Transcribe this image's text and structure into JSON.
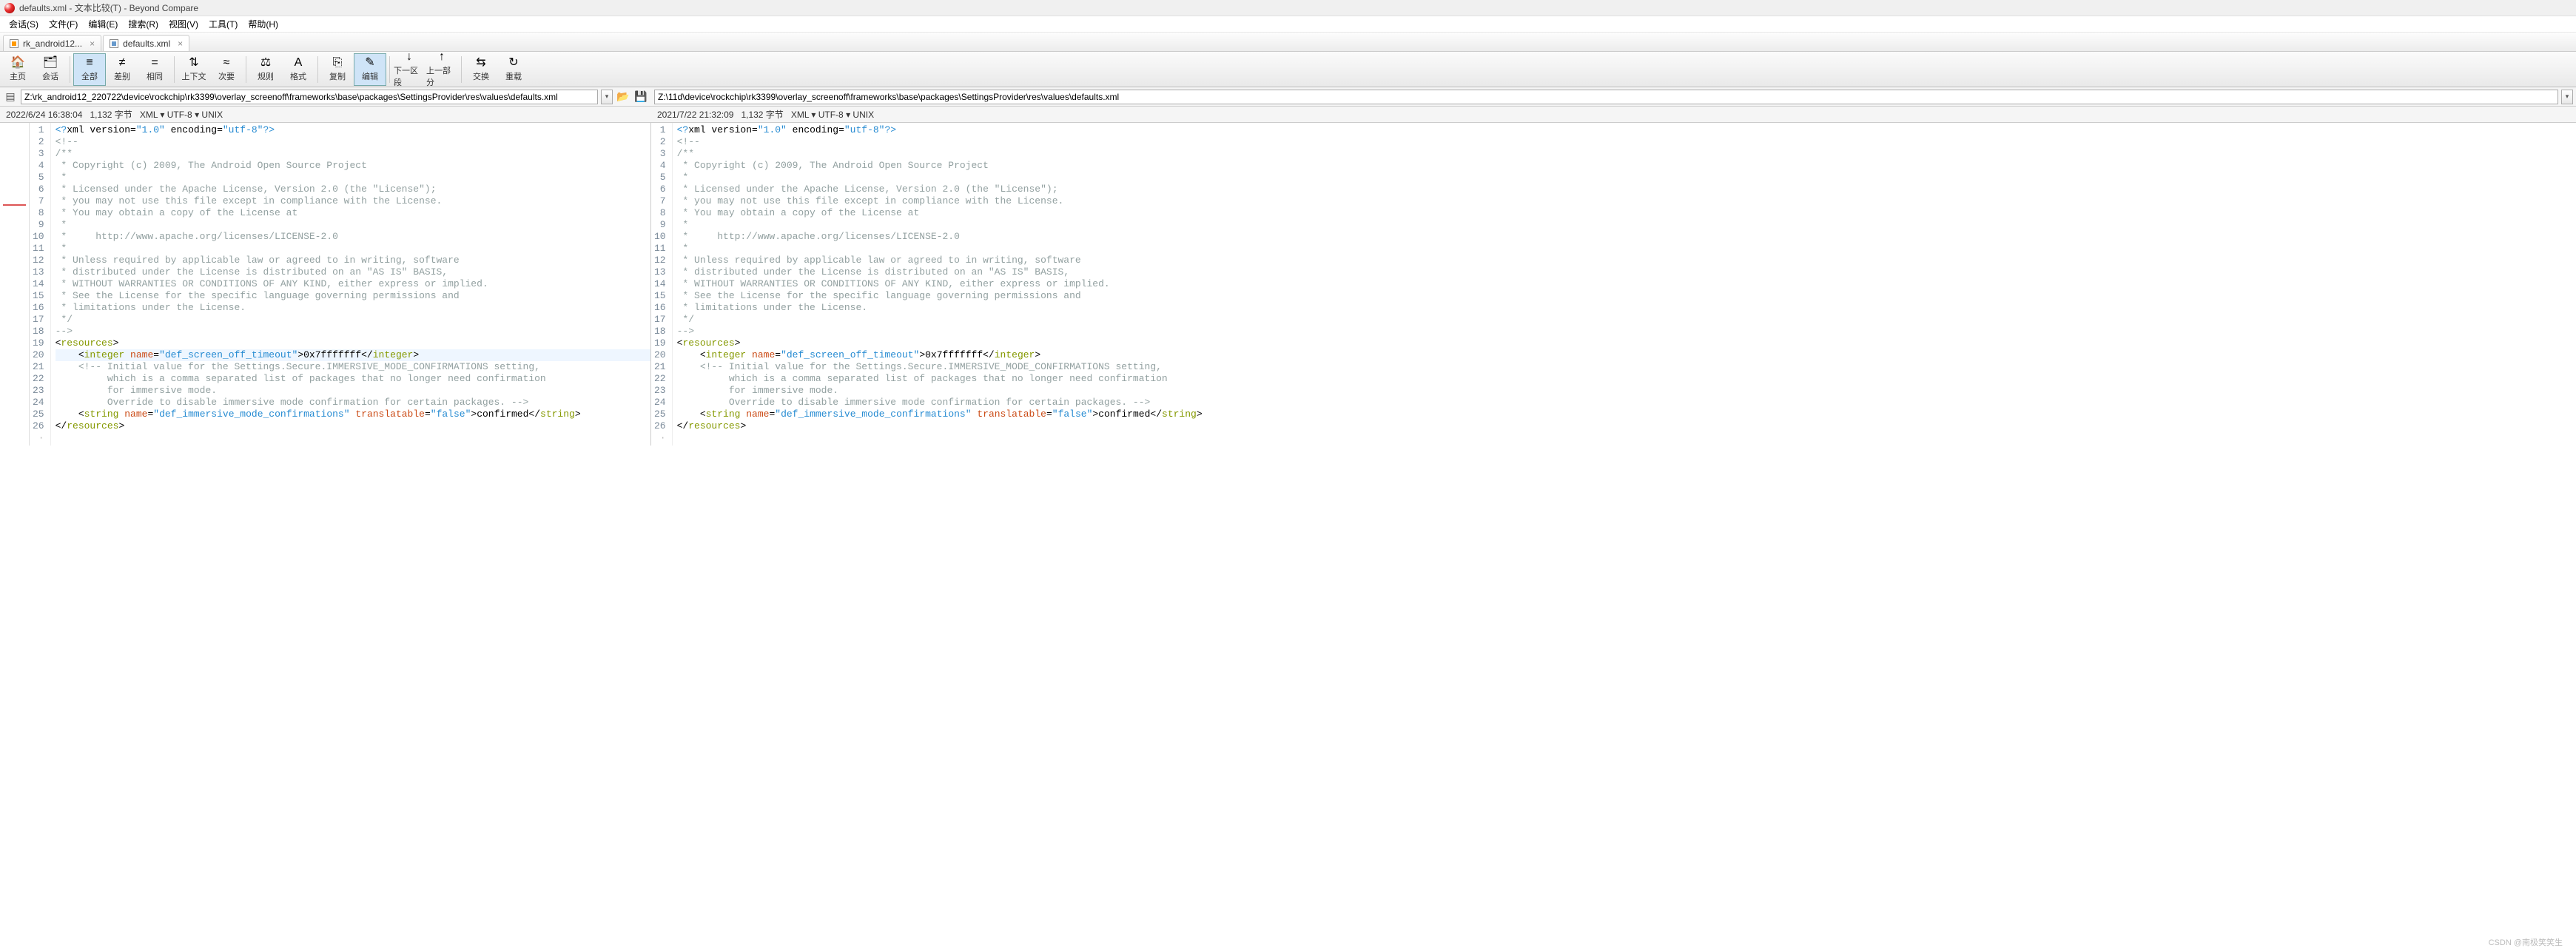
{
  "title": "defaults.xml - 文本比较(T) - Beyond Compare",
  "menu": [
    "会话(S)",
    "文件(F)",
    "编辑(E)",
    "搜索(R)",
    "视图(V)",
    "工具(T)",
    "帮助(H)"
  ],
  "tabs": [
    {
      "label": "rk_android12...",
      "icon": "orange",
      "active": false
    },
    {
      "label": "defaults.xml",
      "icon": "blue",
      "active": true
    }
  ],
  "tools": [
    {
      "label": "主页",
      "icon": "🏠"
    },
    {
      "label": "会话",
      "icon": "🗂"
    },
    {
      "sep": true
    },
    {
      "label": "全部",
      "icon": "≡",
      "active": true
    },
    {
      "label": "差别",
      "icon": "≠"
    },
    {
      "label": "相同",
      "icon": "="
    },
    {
      "sep": true
    },
    {
      "label": "上下文",
      "icon": "⇅"
    },
    {
      "label": "次要",
      "icon": "≈"
    },
    {
      "sep": true
    },
    {
      "label": "规则",
      "icon": "⚖"
    },
    {
      "label": "格式",
      "icon": "A"
    },
    {
      "sep": true
    },
    {
      "label": "复制",
      "icon": "⎘"
    },
    {
      "label": "编辑",
      "icon": "✎",
      "active": true
    },
    {
      "sep": true
    },
    {
      "label": "下一区段",
      "icon": "↓"
    },
    {
      "label": "上一部分",
      "icon": "↑"
    },
    {
      "sep": true
    },
    {
      "label": "交换",
      "icon": "⇆"
    },
    {
      "label": "重载",
      "icon": "↻"
    }
  ],
  "left": {
    "path": "Z:\\rk_android12_220722\\device\\rockchip\\rk3399\\overlay_screenoff\\frameworks\\base\\packages\\SettingsProvider\\res\\values\\defaults.xml",
    "date": "2022/6/24 16:38:04",
    "size": "1,132 字节",
    "fmt": "XML ▾ UTF-8 ▾ UNIX"
  },
  "right": {
    "path": "Z:\\11d\\device\\rockchip\\rk3399\\overlay_screenoff\\frameworks\\base\\packages\\SettingsProvider\\res\\values\\defaults.xml",
    "date": "2021/7/22 21:32:09",
    "size": "1,132 字节",
    "fmt": "XML ▾ UTF-8 ▾ UNIX"
  },
  "code_lines": [
    "<?xml version=\"1.0\" encoding=\"utf-8\"?>",
    "<!--",
    "/**",
    " * Copyright (c) 2009, The Android Open Source Project",
    " *",
    " * Licensed under the Apache License, Version 2.0 (the \"License\");",
    " * you may not use this file except in compliance with the License.",
    " * You may obtain a copy of the License at",
    " *",
    " *     http://www.apache.org/licenses/LICENSE-2.0",
    " *",
    " * Unless required by applicable law or agreed to in writing, software",
    " * distributed under the License is distributed on an \"AS IS\" BASIS,",
    " * WITHOUT WARRANTIES OR CONDITIONS OF ANY KIND, either express or implied.",
    " * See the License for the specific language governing permissions and",
    " * limitations under the License.",
    " */",
    "-->",
    "<resources>",
    "    <integer name=\"def_screen_off_timeout\">0x7fffffff</integer>",
    "    <!-- Initial value for the Settings.Secure.IMMERSIVE_MODE_CONFIRMATIONS setting,",
    "         which is a comma separated list of packages that no longer need confirmation",
    "         for immersive mode.",
    "         Override to disable immersive mode confirmation for certain packages. -->",
    "    <string name=\"def_immersive_mode_confirmations\" translatable=\"false\">confirmed</string>",
    "</resources>"
  ],
  "watermark": "CSDN @南极笑笑生"
}
